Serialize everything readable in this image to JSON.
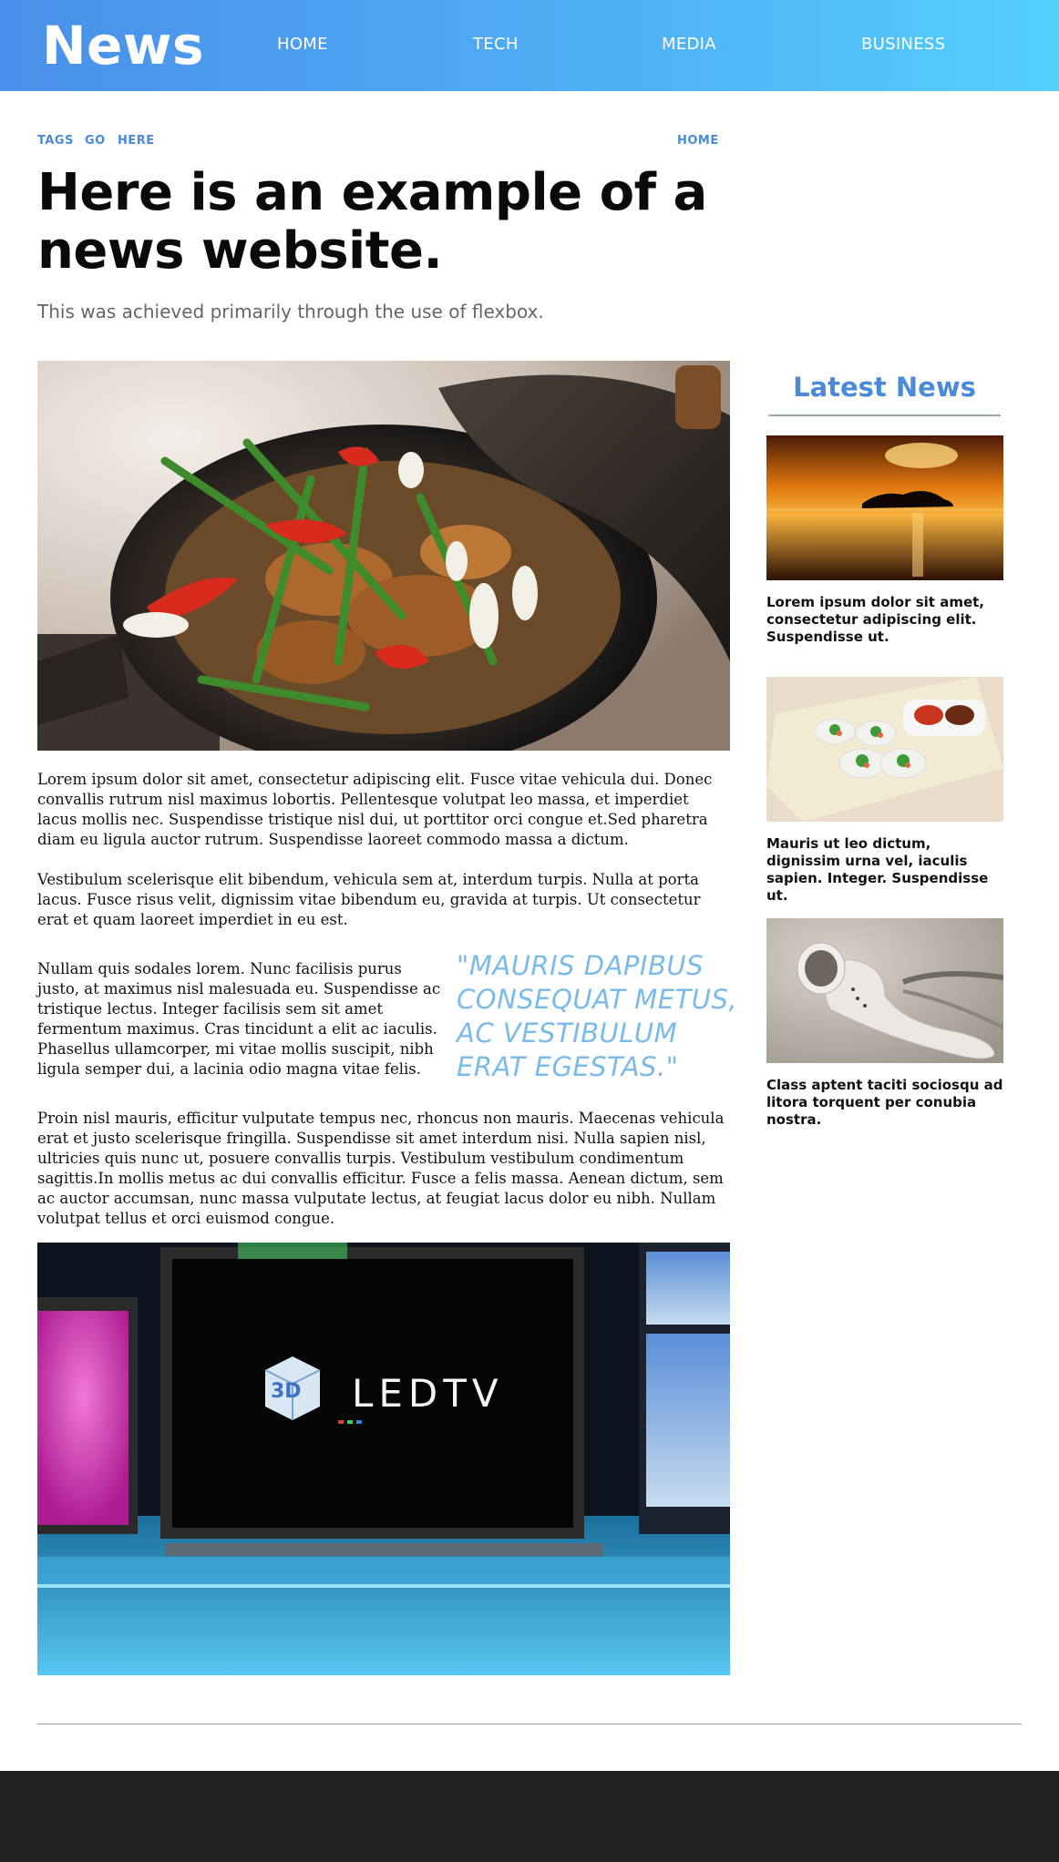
{
  "header": {
    "logo": "News",
    "nav": [
      "HOME",
      "TECH",
      "MEDIA",
      "BUSINESS"
    ]
  },
  "tags": [
    "TAGS",
    "GO",
    "HERE"
  ],
  "breadcrumb_home": "HOME",
  "article": {
    "title": "Here is an example of a news website.",
    "subtitle": "This was achieved primarily through the use of flexbox.",
    "paragraphs": [
      "Lorem ipsum dolor sit amet, consectetur adipiscing elit. Fusce vitae vehicula dui. Donec convallis rutrum nisl maximus lobortis. Pellentesque volutpat leo massa, et imperdiet lacus mollis nec. Suspendisse tristique nisl dui, ut porttitor orci congue et.Sed pharetra diam eu ligula auctor rutrum. Suspendisse laoreet commodo massa a dictum.",
      "Vestibulum scelerisque elit bibendum, vehicula sem at, interdum turpis. Nulla at porta lacus. Fusce risus velit, dignissim vitae bibendum eu, gravida at turpis. Ut consectetur erat et quam laoreet imperdiet in eu est.",
      "Nullam quis sodales lorem. Nunc facilisis purus justo, at maximus nisl malesuada eu. Suspendisse ac tristique lectus. Integer facilisis sem sit amet fermentum maximus. Cras tincidunt a elit ac iaculis. Phasellus ullamcorper, mi vitae mollis suscipit, nibh ligula semper dui, a lacinia odio magna vitae felis.",
      "Proin nisl mauris, efficitur vulputate tempus nec, rhoncus non mauris. Maecenas vehicula erat et justo scelerisque fringilla. Suspendisse sit amet interdum nisi. Nulla sapien nisl, ultricies quis nunc ut, posuere convallis turpis. Vestibulum vestibulum condimentum sagittis.In mollis metus ac dui convallis efficitur. Fusce a felis massa. Aenean dictum, sem ac auctor accumsan, nunc massa vulputate lectus, at feugiat lacus dolor eu nibh. Nullam volutpat tellus et orci euismod congue."
    ],
    "pullquote": "\"MAURIS DAPIBUS CONSEQUAT METUS, AC VESTIBULUM ERAT EGESTAS.\"",
    "tv_logo_3d": "3D",
    "tv_logo_text": "LEDTV"
  },
  "sidebar": {
    "title": "Latest News",
    "items": [
      {
        "caption": "Lorem ipsum dolor sit amet, consectetur adipiscing elit. Suspendisse ut."
      },
      {
        "caption": "Mauris ut leo dictum, dignissim urna vel, iaculis sapien. Integer. Suspendisse ut."
      },
      {
        "caption": "Class aptent taciti sociosqu ad litora torquent per conubia nostra."
      }
    ]
  },
  "colors": {
    "header_gradient_start": "#4a8fea",
    "header_gradient_end": "#55d0fd",
    "accent_blue": "#4a8ad8",
    "pullquote": "#7bbbe9",
    "footer": "#222222"
  }
}
